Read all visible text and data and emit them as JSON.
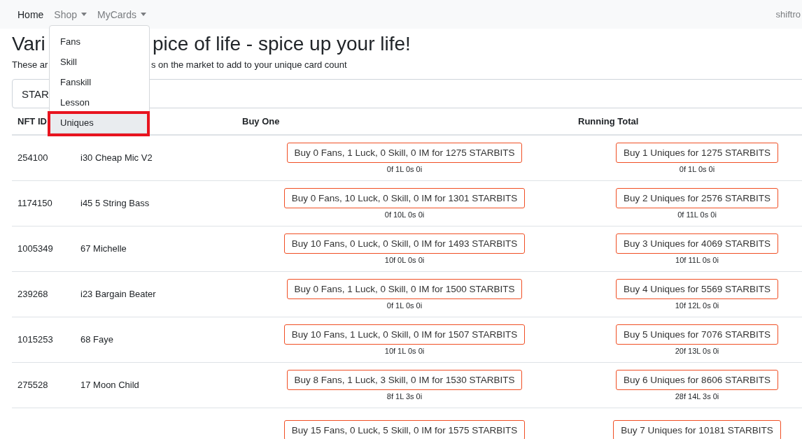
{
  "navbar": {
    "items": [
      {
        "label": "Home",
        "selected": true,
        "dropdown": false
      },
      {
        "label": "Shop",
        "selected": false,
        "dropdown": true
      },
      {
        "label": "MyCards",
        "selected": false,
        "dropdown": true
      }
    ],
    "user": "shiftro"
  },
  "dropdown_menu": {
    "items": [
      {
        "label": "Fans",
        "selected": false
      },
      {
        "label": "Skill",
        "selected": false
      },
      {
        "label": "Fanskill",
        "selected": false
      },
      {
        "label": "Lesson",
        "selected": false
      },
      {
        "label": "Uniques",
        "selected": true
      }
    ]
  },
  "heading": {
    "start": "Vari",
    "end": "pice of life - spice up your life!"
  },
  "subtitle": {
    "start": "These ar",
    "end": "s on the market to add to your unique card count"
  },
  "currency_field": {
    "value": "STAR"
  },
  "table": {
    "columns": [
      "NFT ID",
      "Buy One",
      "Running Total"
    ],
    "rows": [
      {
        "nft_id": "254100",
        "name": "i30 Cheap Mic V2",
        "buy_one": "Buy 0 Fans, 1 Luck, 0 Skill, 0 IM for 1275 STARBITS",
        "buy_one_detail": "0f 1L 0s 0i",
        "running": "Buy 1 Uniques for 1275 STARBITS",
        "running_detail": "0f 1L 0s 0i"
      },
      {
        "nft_id": "1174150",
        "name": "i45 5 String Bass",
        "buy_one": "Buy 0 Fans, 10 Luck, 0 Skill, 0 IM for 1301 STARBITS",
        "buy_one_detail": "0f 10L 0s 0i",
        "running": "Buy 2 Uniques for 2576 STARBITS",
        "running_detail": "0f 11L 0s 0i"
      },
      {
        "nft_id": "1005349",
        "name": "67 Michelle",
        "buy_one": "Buy 10 Fans, 0 Luck, 0 Skill, 0 IM for 1493 STARBITS",
        "buy_one_detail": "10f 0L 0s 0i",
        "running": "Buy 3 Uniques for 4069 STARBITS",
        "running_detail": "10f 11L 0s 0i"
      },
      {
        "nft_id": "239268",
        "name": "i23 Bargain Beater",
        "buy_one": "Buy 0 Fans, 1 Luck, 0 Skill, 0 IM for 1500 STARBITS",
        "buy_one_detail": "0f 1L 0s 0i",
        "running": "Buy 4 Uniques for 5569 STARBITS",
        "running_detail": "10f 12L 0s 0i"
      },
      {
        "nft_id": "1015253",
        "name": "68 Faye",
        "buy_one": "Buy 10 Fans, 1 Luck, 0 Skill, 0 IM for 1507 STARBITS",
        "buy_one_detail": "10f 1L 0s 0i",
        "running": "Buy 5 Uniques for 7076 STARBITS",
        "running_detail": "20f 13L 0s 0i"
      },
      {
        "nft_id": "275528",
        "name": "17 Moon Child",
        "buy_one": "Buy 8 Fans, 1 Luck, 3 Skill, 0 IM for 1530 STARBITS",
        "buy_one_detail": "8f 1L 3s 0i",
        "running": "Buy 6 Uniques for 8606 STARBITS",
        "running_detail": "28f 14L 3s 0i"
      },
      {
        "buy_one": "Buy 15 Fans, 0 Luck, 5 Skill, 0 IM for 1575 STARBITS",
        "running": "Buy 7 Uniques for 10181 STARBITS"
      }
    ]
  }
}
